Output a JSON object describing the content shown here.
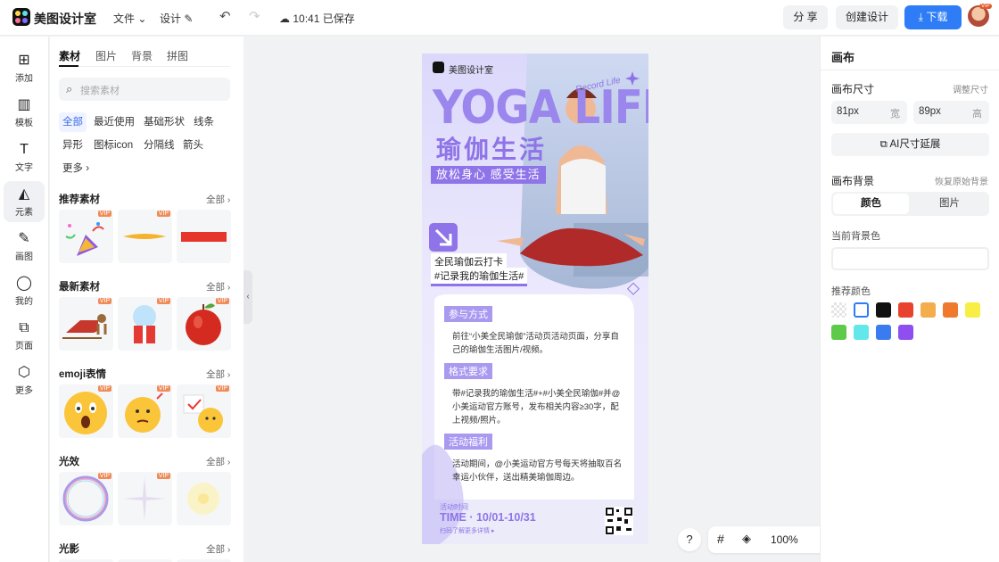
{
  "app": {
    "name": "美图设计室",
    "saved_status": "10:41 已保存"
  },
  "topbar": {
    "file_menu": "文件",
    "design_menu": "设计",
    "share_button": "分 享",
    "create_button": "创建设计",
    "download_button": "下载",
    "vip_badge": "VIP"
  },
  "nav": {
    "items": [
      {
        "label": "添加",
        "icon": "plus-square-icon"
      },
      {
        "label": "模板",
        "icon": "template-icon"
      },
      {
        "label": "文字",
        "icon": "text-icon"
      },
      {
        "label": "元素",
        "icon": "shapes-icon"
      },
      {
        "label": "画图",
        "icon": "draw-icon"
      },
      {
        "label": "我的",
        "icon": "user-icon"
      },
      {
        "label": "页面",
        "icon": "add-page-icon"
      },
      {
        "label": "更多",
        "icon": "cube-icon"
      }
    ]
  },
  "panel": {
    "tabs": [
      "素材",
      "图片",
      "背景",
      "拼图"
    ],
    "search_placeholder": "搜索素材",
    "chips": [
      "全部",
      "最近使用",
      "基础形状",
      "线条",
      "异形",
      "图标icon",
      "分隔线",
      "箭头",
      "更多"
    ],
    "see_all": "全部",
    "vip": "VIP",
    "sections": [
      "推荐素材",
      "最新素材",
      "emoji表情",
      "光效",
      "光影"
    ]
  },
  "poster": {
    "brand": "美图设计室",
    "title_en": "YOGA LIFE",
    "script": "Record Life",
    "title_cn": "瑜伽生活",
    "subtitle": "放松身心 感受生活",
    "checkin_1": "全民瑜伽云打卡",
    "checkin_2": "#记录我的瑜伽生活#",
    "section1": "参与方式",
    "text1": "前往“小美全民瑜伽”活动页活动页面，分享自己的瑜伽生活图片/视频。",
    "section2": "格式要求",
    "text2": "带#记录我的瑜伽生活#+#小美全民瑜伽#并@小美运动官方账号，发布相关内容≥30字，配上视频/照片。",
    "section3": "活动福利",
    "text3": "活动期间，@小美运动官方号每天将抽取百名幸运小伙伴，送出精美瑜伽周边。",
    "time_label": "活动时间",
    "time": "TIME · 10/01-10/31",
    "scan_text": "扫码了解更多详情 ▸"
  },
  "right": {
    "title": "画布",
    "size_label": "画布尺寸",
    "adjust_size": "调整尺寸",
    "width_value": "81px",
    "width_unit": "宽",
    "height_value": "89px",
    "height_unit": "高",
    "ai_button": "AI尺寸延展",
    "bg_label": "画布背景",
    "restore_bg": "恢复原始背景",
    "tab_color": "颜色",
    "tab_image": "图片",
    "current_bg": "当前背景色",
    "recommend": "推荐颜色",
    "swatches": [
      "transparent",
      "#ffffff",
      "#111111",
      "#e8432e",
      "#f3ad4d",
      "#ef7a2d",
      "#f8ee46",
      "#5dca4a",
      "#62e8ea",
      "#3a7cf0",
      "#8f4ff0"
    ]
  },
  "zoom": {
    "help": "?",
    "zoom_value": "100%"
  }
}
